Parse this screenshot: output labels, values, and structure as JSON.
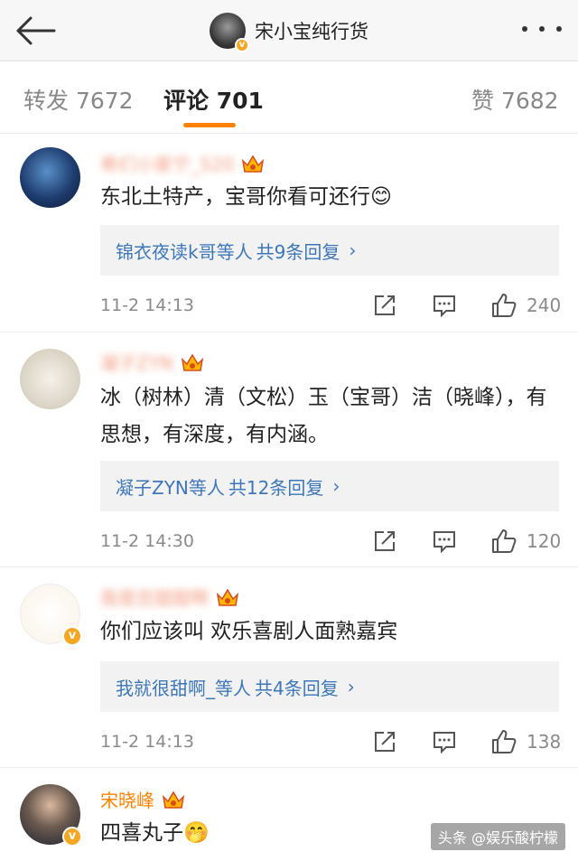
{
  "header": {
    "title": "宋小宝纯行货",
    "back_icon": "back-arrow-icon",
    "more_icon": "more-dots-icon"
  },
  "tabs": [
    {
      "label": "转发 7672",
      "active": false
    },
    {
      "label": "评论 701",
      "active": true
    },
    {
      "label": "赞 7682",
      "active": false
    }
  ],
  "comments": [
    {
      "username": "希们小家宁_520",
      "badge": "crown-icon",
      "text": "东北土特产，宝哥你看可还行😊",
      "reply_users": "锦衣夜读k哥等人",
      "reply_count": "共9条回复",
      "time": "11-2 14:13",
      "likes": "240"
    },
    {
      "username": "凝子ZYN",
      "badge": "crown-icon",
      "text": "冰（树林）清（文松）玉（宝哥）洁（晓峰），有思想，有深度，有内涵。",
      "reply_users": "凝子ZYN等人",
      "reply_count": "共12条回复",
      "time": "11-2 14:30",
      "likes": "120"
    },
    {
      "username": "我是您甜甜啊",
      "badge": "crown-icon",
      "text": "你们应该叫 欢乐喜剧人面熟嘉宾",
      "reply_users": "我就很甜啊_等人",
      "reply_count": "共4条回复",
      "time": "11-2 14:13",
      "likes": "138"
    },
    {
      "username": "宋晓峰",
      "badge": "crown-icon",
      "text": "四喜丸子🤭"
    }
  ],
  "watermark": "头条 @娱乐酸柠檬",
  "colors": {
    "accent": "#ff8200",
    "link": "#3d77b8"
  }
}
